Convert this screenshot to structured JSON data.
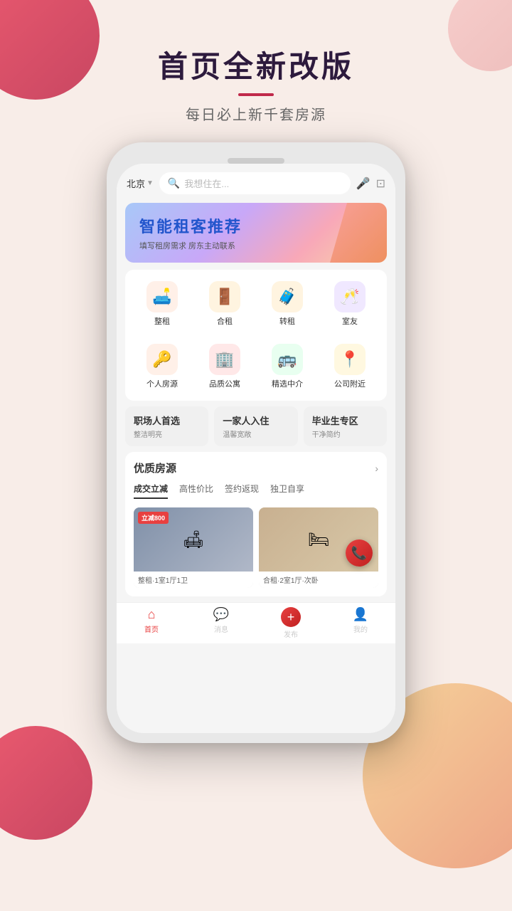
{
  "background": {
    "color": "#f8ede8"
  },
  "header": {
    "main_title": "首页全新改版",
    "underline_color": "#c0294a",
    "subtitle": "每日必上新千套房源"
  },
  "phone": {
    "search": {
      "city": "北京",
      "city_arrow": "▼",
      "placeholder": "我想住在...",
      "mic_icon": "🎤",
      "scan_icon": "⊡"
    },
    "banner": {
      "title": "智能租客推荐",
      "subtitle": "填写租房需求  房东主动联系"
    },
    "icon_grid": [
      {
        "icon": "🛋️",
        "label": "整租",
        "bg": "#fff0e8"
      },
      {
        "icon": "🚪",
        "label": "合租",
        "bg": "#fff4e0"
      },
      {
        "icon": "🧳",
        "label": "转租",
        "bg": "#fff4e0"
      },
      {
        "icon": "🥂",
        "label": "室友",
        "bg": "#f0e8ff"
      },
      {
        "icon": "🔑",
        "label": "个人房源",
        "bg": "#fff0e8"
      },
      {
        "icon": "🏢",
        "label": "品质公寓",
        "bg": "#ffe8e8"
      },
      {
        "icon": "🚌",
        "label": "精选中介",
        "bg": "#e8fff0"
      },
      {
        "icon": "📍",
        "label": "公司附近",
        "bg": "#fff8e0"
      }
    ],
    "feature_banners": [
      {
        "title": "职场人首选",
        "subtitle": "整洁明亮"
      },
      {
        "title": "一家人入住",
        "subtitle": "温馨宽敞"
      },
      {
        "title": "毕业生专区",
        "subtitle": "干净简约"
      }
    ],
    "quality_section": {
      "title": "优质房源",
      "arrow": "›",
      "tabs": [
        {
          "label": "成交立减",
          "active": true
        },
        {
          "label": "高性价比",
          "active": false
        },
        {
          "label": "签约返现",
          "active": false
        },
        {
          "label": "独卫自享",
          "active": false
        }
      ],
      "listings": [
        {
          "badge": "立减800",
          "desc": "整租·1室1厅1卫",
          "type": "living"
        },
        {
          "badge": "",
          "desc": "合租·2室1厅·次卧",
          "type": "bedroom"
        }
      ]
    },
    "bottom_nav": [
      {
        "icon": "⌂",
        "label": "首页",
        "active": true
      },
      {
        "icon": "💬",
        "label": "消息",
        "active": false
      },
      {
        "icon": "+",
        "label": "发布",
        "active": false,
        "special": true
      },
      {
        "icon": "👤",
        "label": "我的",
        "active": false
      }
    ]
  }
}
